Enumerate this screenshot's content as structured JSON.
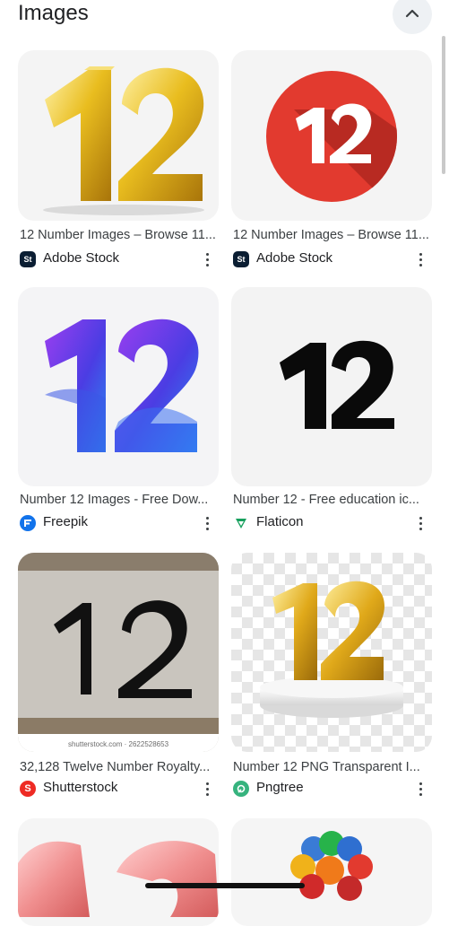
{
  "section": {
    "title": "Images"
  },
  "results": [
    {
      "caption": "12 Number Images – Browse 11...",
      "source": "Adobe Stock",
      "logo": "adobe-stock-logo",
      "logo_text": "St",
      "logo_color": "#0b1e33"
    },
    {
      "caption": "12 Number Images – Browse 11...",
      "source": "Adobe Stock",
      "logo": "adobe-stock-logo",
      "logo_text": "St",
      "logo_color": "#0b1e33"
    },
    {
      "caption": "Number 12 Images - Free Dow...",
      "source": "Freepik",
      "logo": "freepik-logo",
      "logo_color": "#1273eb"
    },
    {
      "caption": "Number 12 - Free education ic...",
      "source": "Flaticon",
      "logo": "flaticon-logo",
      "logo_color": "#17a05e"
    },
    {
      "caption": "32,128 Twelve Number Royalty...",
      "source": "Shutterstock",
      "logo": "shutterstock-logo",
      "logo_text": "S",
      "logo_color": "#ee2b24",
      "watermark": "shutterstock.com · 2622528653"
    },
    {
      "caption": "Number 12 PNG Transparent I...",
      "source": "Pngtree",
      "logo": "pngtree-logo",
      "logo_color": "#36b37e"
    }
  ],
  "icons": {
    "collapse": "chevron-up-icon",
    "more": "more-vert-icon"
  }
}
